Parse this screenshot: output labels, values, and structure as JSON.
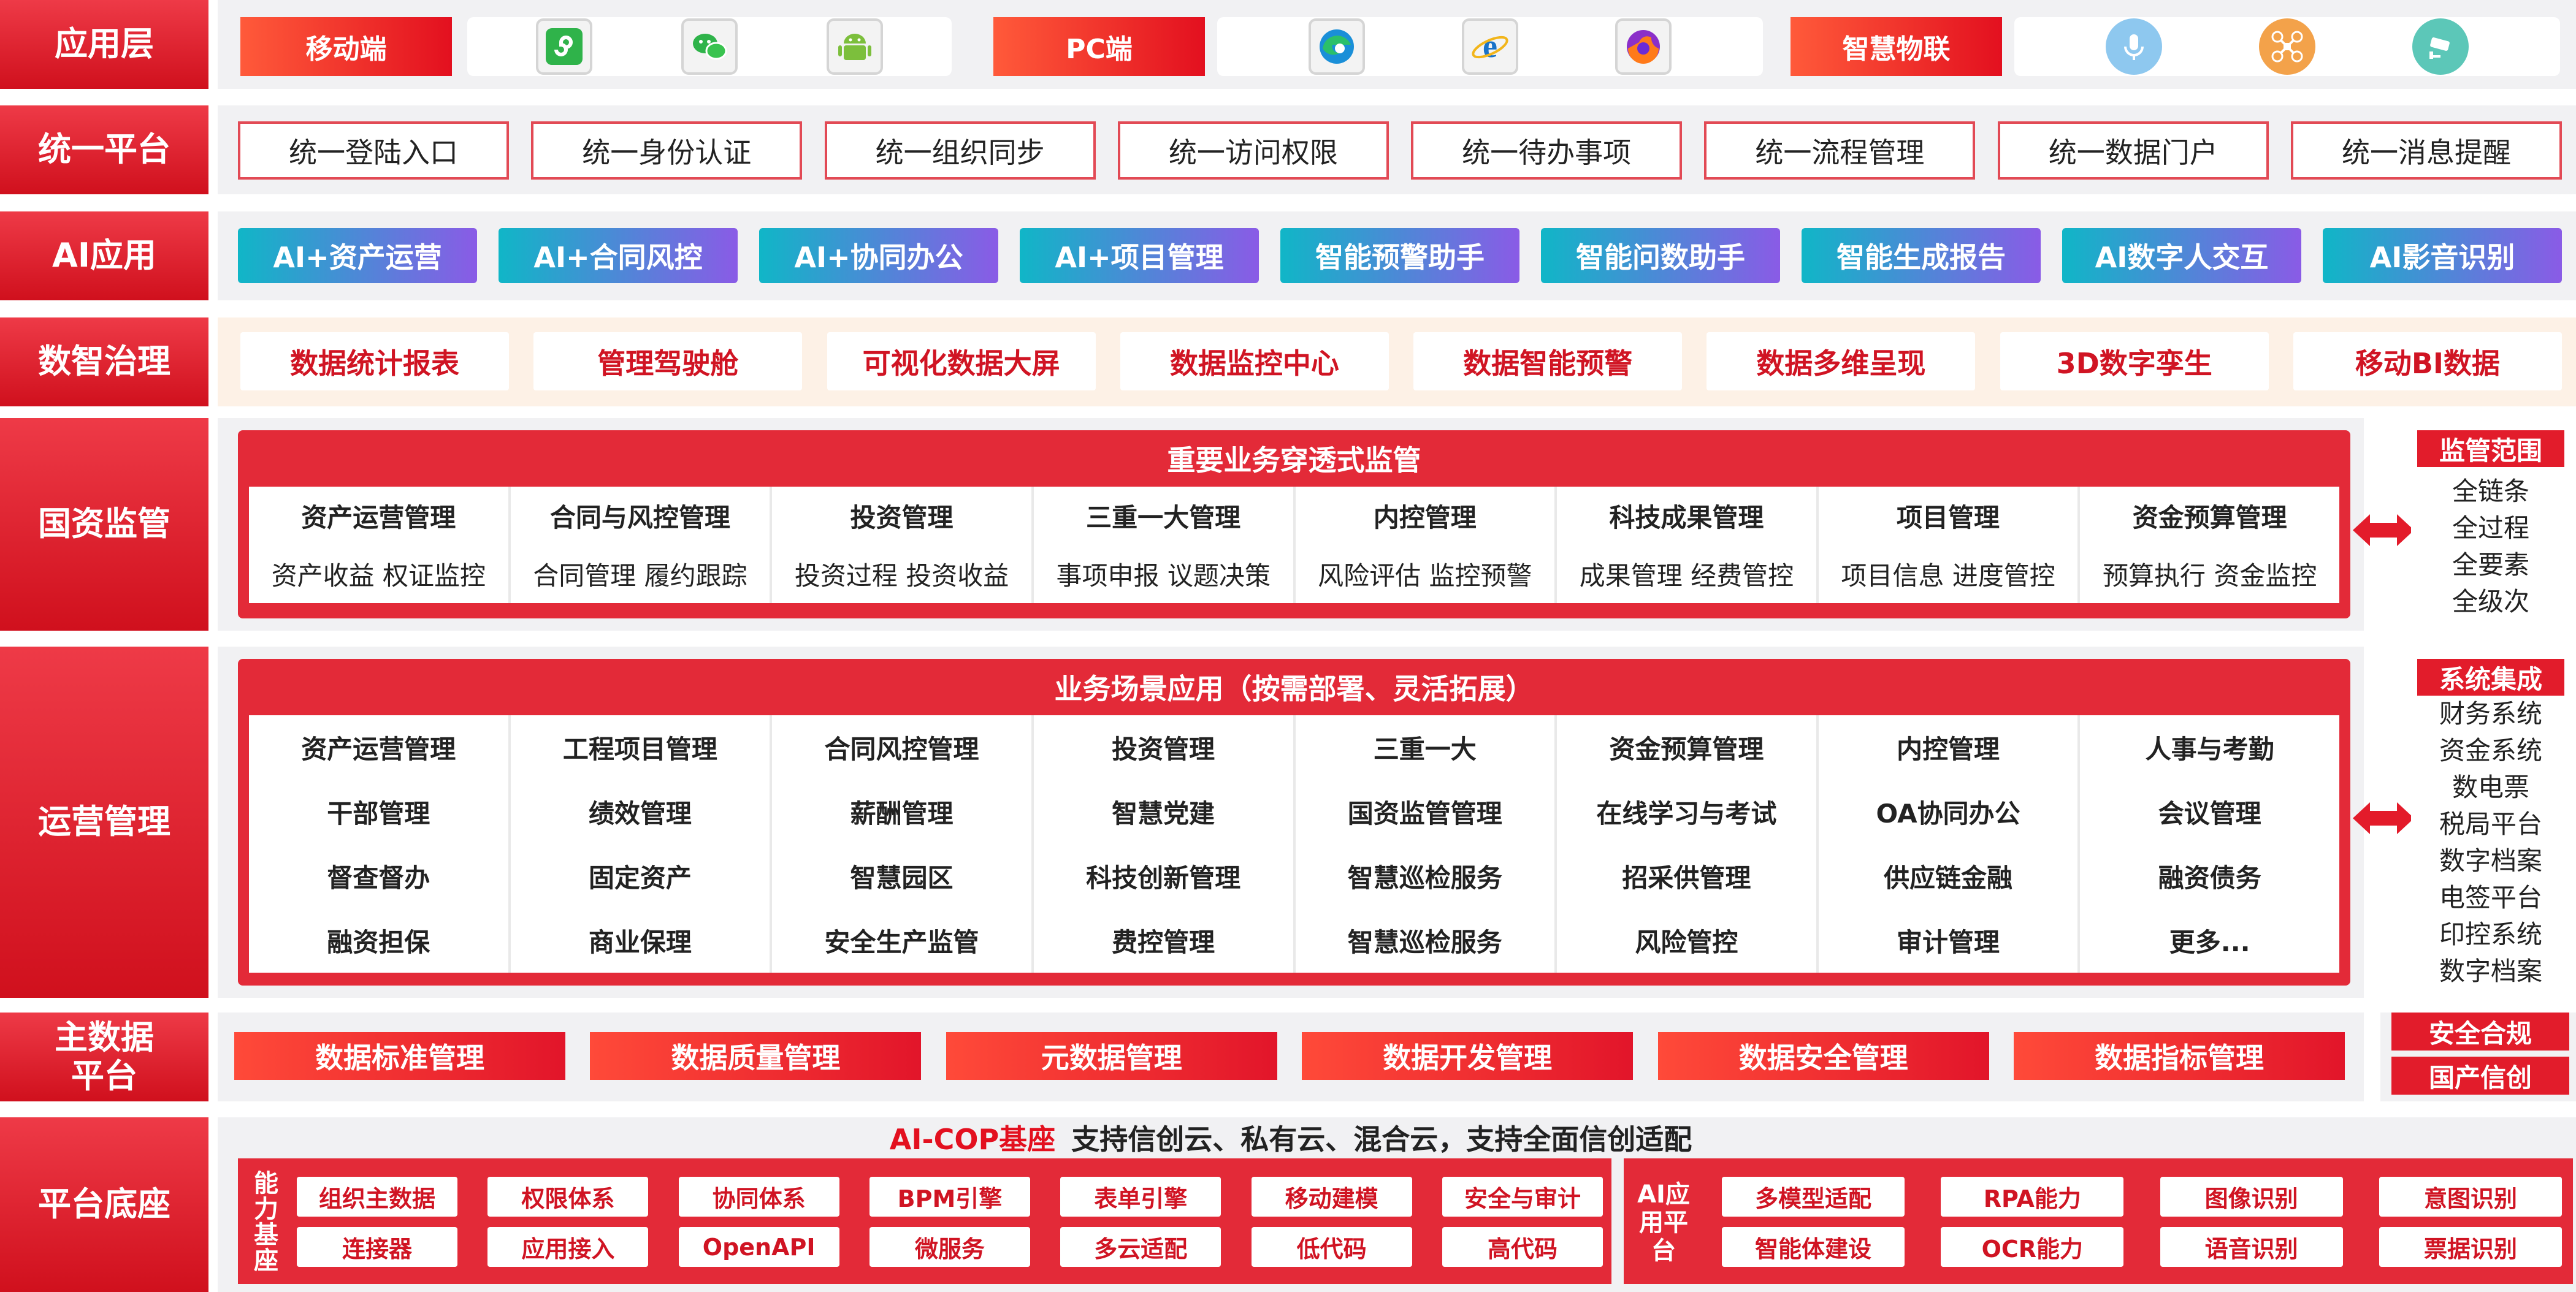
{
  "rows": {
    "app": "应用层",
    "platform": "统一平台",
    "ai": "AI应用",
    "gov": "数智治理",
    "sa": "国资监管",
    "ops": "运营管理",
    "md": "主数据平台",
    "base": "平台底座"
  },
  "app_layer": {
    "mobile": {
      "label": "移动端",
      "icons": [
        "mini-program-icon",
        "wechat-icon",
        "android-icon"
      ]
    },
    "pc": {
      "label": "PC端",
      "icons": [
        "edge-browser-icon",
        "ie-browser-icon",
        "firefox-icon"
      ]
    },
    "iot": {
      "label": "智慧物联",
      "icons": [
        "microphone-icon",
        "drone-icon",
        "camera-icon"
      ]
    }
  },
  "unified": [
    "统一登陆入口",
    "统一身份认证",
    "统一组织同步",
    "统一访问权限",
    "统一待办事项",
    "统一流程管理",
    "统一数据门户",
    "统一消息提醒"
  ],
  "ai_apps": [
    "AI+资产运营",
    "AI+合同风控",
    "AI+协同办公",
    "AI+项目管理",
    "智能预警助手",
    "智能问数助手",
    "智能生成报告",
    "AI数字人交互",
    "AI影音识别"
  ],
  "governance": [
    "数据统计报表",
    "管理驾驶舱",
    "可视化数据大屏",
    "数据监控中心",
    "数据智能预警",
    "数据多维呈现",
    "3D数字孪生",
    "移动BI数据"
  ],
  "supervision": {
    "title": "重要业务穿透式监管",
    "columns": [
      {
        "name": "资产运营管理",
        "sub": "资产收益 权证监控"
      },
      {
        "name": "合同与风控管理",
        "sub": "合同管理 履约跟踪"
      },
      {
        "name": "投资管理",
        "sub": "投资过程 投资收益"
      },
      {
        "name": "三重一大管理",
        "sub": "事项申报 议题决策"
      },
      {
        "name": "内控管理",
        "sub": "风险评估 监控预警"
      },
      {
        "name": "科技成果管理",
        "sub": "成果管理 经费管控"
      },
      {
        "name": "项目管理",
        "sub": "项目信息 进度管控"
      },
      {
        "name": "资金预算管理",
        "sub": "预算执行 资金监控"
      }
    ],
    "scope": {
      "title": "监管范围",
      "items": [
        "全链条",
        "全过程",
        "全要素",
        "全级次"
      ]
    }
  },
  "operations": {
    "title": "业务场景应用（按需部署、灵活拓展）",
    "columns": [
      [
        "资产运营管理",
        "干部管理",
        "督查督办",
        "融资担保"
      ],
      [
        "工程项目管理",
        "绩效管理",
        "固定资产",
        "商业保理"
      ],
      [
        "合同风控管理",
        "薪酬管理",
        "智慧园区",
        "安全生产监管"
      ],
      [
        "投资管理",
        "智慧党建",
        "科技创新管理",
        "费控管理"
      ],
      [
        "三重一大",
        "国资监管管理",
        "智慧巡检服务",
        "智慧巡检服务"
      ],
      [
        "资金预算管理",
        "在线学习与考试",
        "招采供管理",
        "风险管控"
      ],
      [
        "内控管理",
        "OA协同办公",
        "供应链金融",
        "审计管理"
      ],
      [
        "人事与考勤",
        "会议管理",
        "融资债务",
        "更多..."
      ]
    ],
    "integration": {
      "title": "系统集成",
      "items": [
        "财务系统",
        "资金系统",
        "数电票",
        "税局平台",
        "数字档案",
        "电签平台",
        "印控系统",
        "数字档案"
      ]
    }
  },
  "master_data": [
    "数据标准管理",
    "数据质量管理",
    "元数据管理",
    "数据开发管理",
    "数据安全管理",
    "数据指标管理"
  ],
  "side_tags": [
    "安全合规",
    "国产信创"
  ],
  "foundation": {
    "title_red": "AI-COP基座",
    "title_rest": "支持信创云、私有云、混合云，支持全面信创适配",
    "capability_label": "能力基座",
    "capability_top": [
      "组织主数据",
      "权限体系",
      "协同体系",
      "BPM引擎",
      "表单引擎",
      "移动建模",
      "安全与审计"
    ],
    "capability_bottom": [
      "连接器",
      "应用接入",
      "OpenAPI",
      "微服务",
      "多云适配",
      "低代码",
      "高代码"
    ],
    "ai_label": "AI应用平台",
    "ai_top": [
      "多模型适配",
      "RPA能力",
      "图像识别",
      "意图识别"
    ],
    "ai_bottom": [
      "智能体建设",
      "OCR能力",
      "语音识别",
      "票据识别"
    ]
  }
}
